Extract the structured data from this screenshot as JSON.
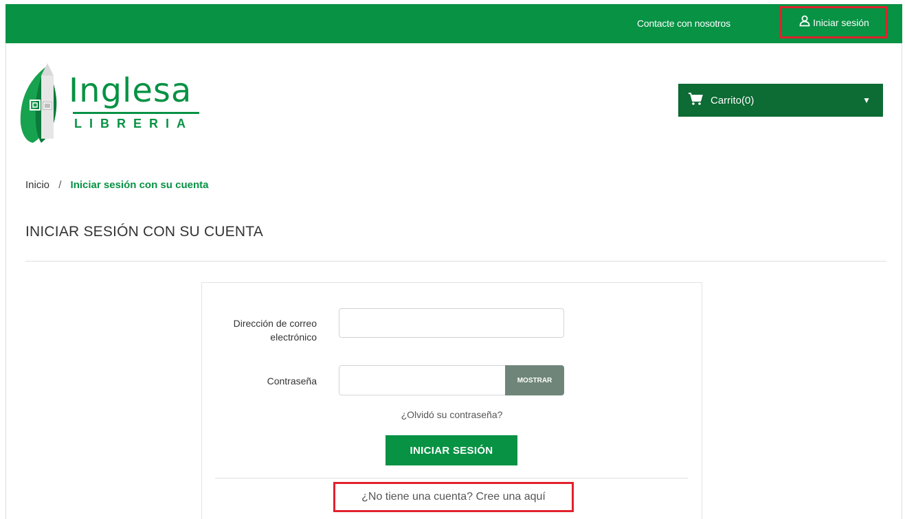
{
  "header": {
    "contact": "Contacte con nosotros",
    "login": "Iniciar sesión",
    "login_icon": "user-icon"
  },
  "logo": {
    "brand": "Inglesa",
    "sub": "LIBRERIA"
  },
  "cart": {
    "label": "Carrito(0)",
    "icon": "cart-icon",
    "caret": "▼"
  },
  "breadcrumb": {
    "home": "Inicio",
    "separator": "/",
    "current": "Iniciar sesión con su cuenta"
  },
  "page": {
    "title": "INICIAR SESIÓN CON SU CUENTA"
  },
  "form": {
    "email_label_line1": "Dirección de correo",
    "email_label_line2": "electrónico",
    "email_value": "",
    "password_label": "Contraseña",
    "password_value": "",
    "show_button": "MOSTRAR",
    "forgot": "¿Olvidó su contraseña?",
    "submit": "INICIAR SESIÓN",
    "create_account": "¿No tiene una cuenta? Cree una aquí"
  },
  "colors": {
    "brand_green": "#079244",
    "dark_green": "#0d6b34",
    "highlight_red": "#e2202c"
  }
}
